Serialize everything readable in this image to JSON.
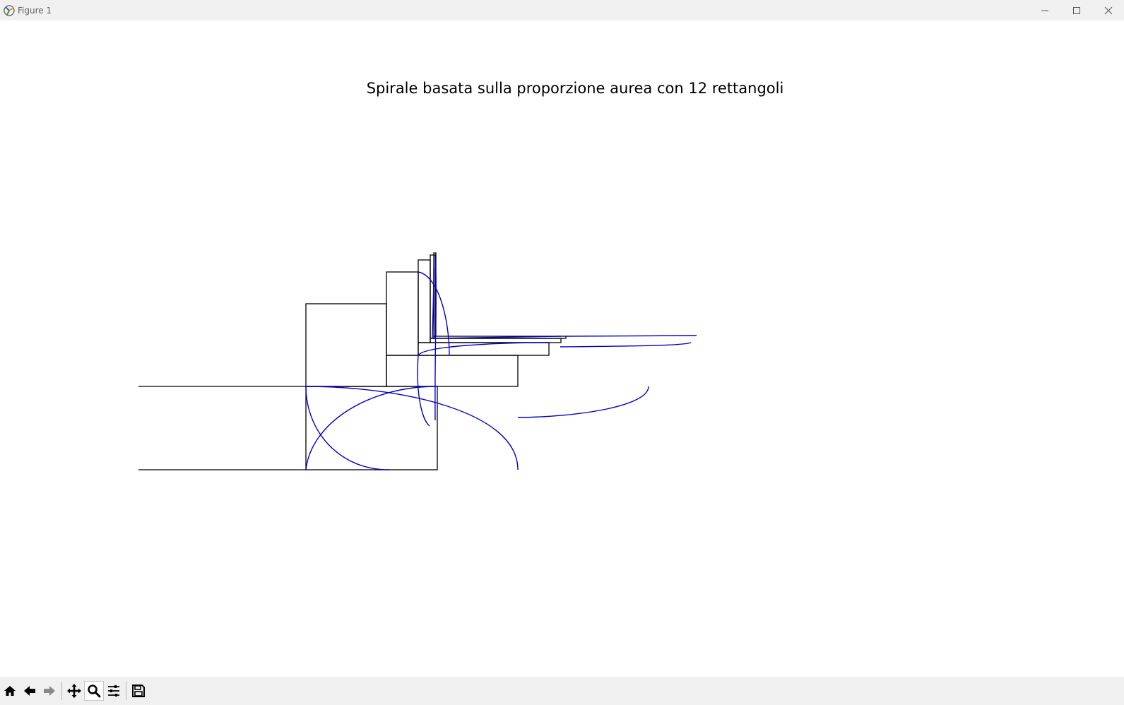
{
  "window": {
    "title": "Figure 1",
    "app_icon": "matplotlib-icon",
    "controls": [
      "minimize-icon",
      "maximize-icon",
      "close-icon"
    ]
  },
  "toolbar": {
    "items": [
      "home-icon",
      "back-icon",
      "forward-icon",
      "pan-icon",
      "zoom-icon",
      "configure-subplots-icon",
      "save-icon"
    ],
    "active": "zoom-icon"
  },
  "chart_data": {
    "type": "diagram",
    "title": "Spirale basata sulla proporzione aurea con 12 rettangoli",
    "axis": "off",
    "grid": false,
    "colors": {
      "rectangles": "#000000",
      "arcs": "#0000cc"
    }
  }
}
